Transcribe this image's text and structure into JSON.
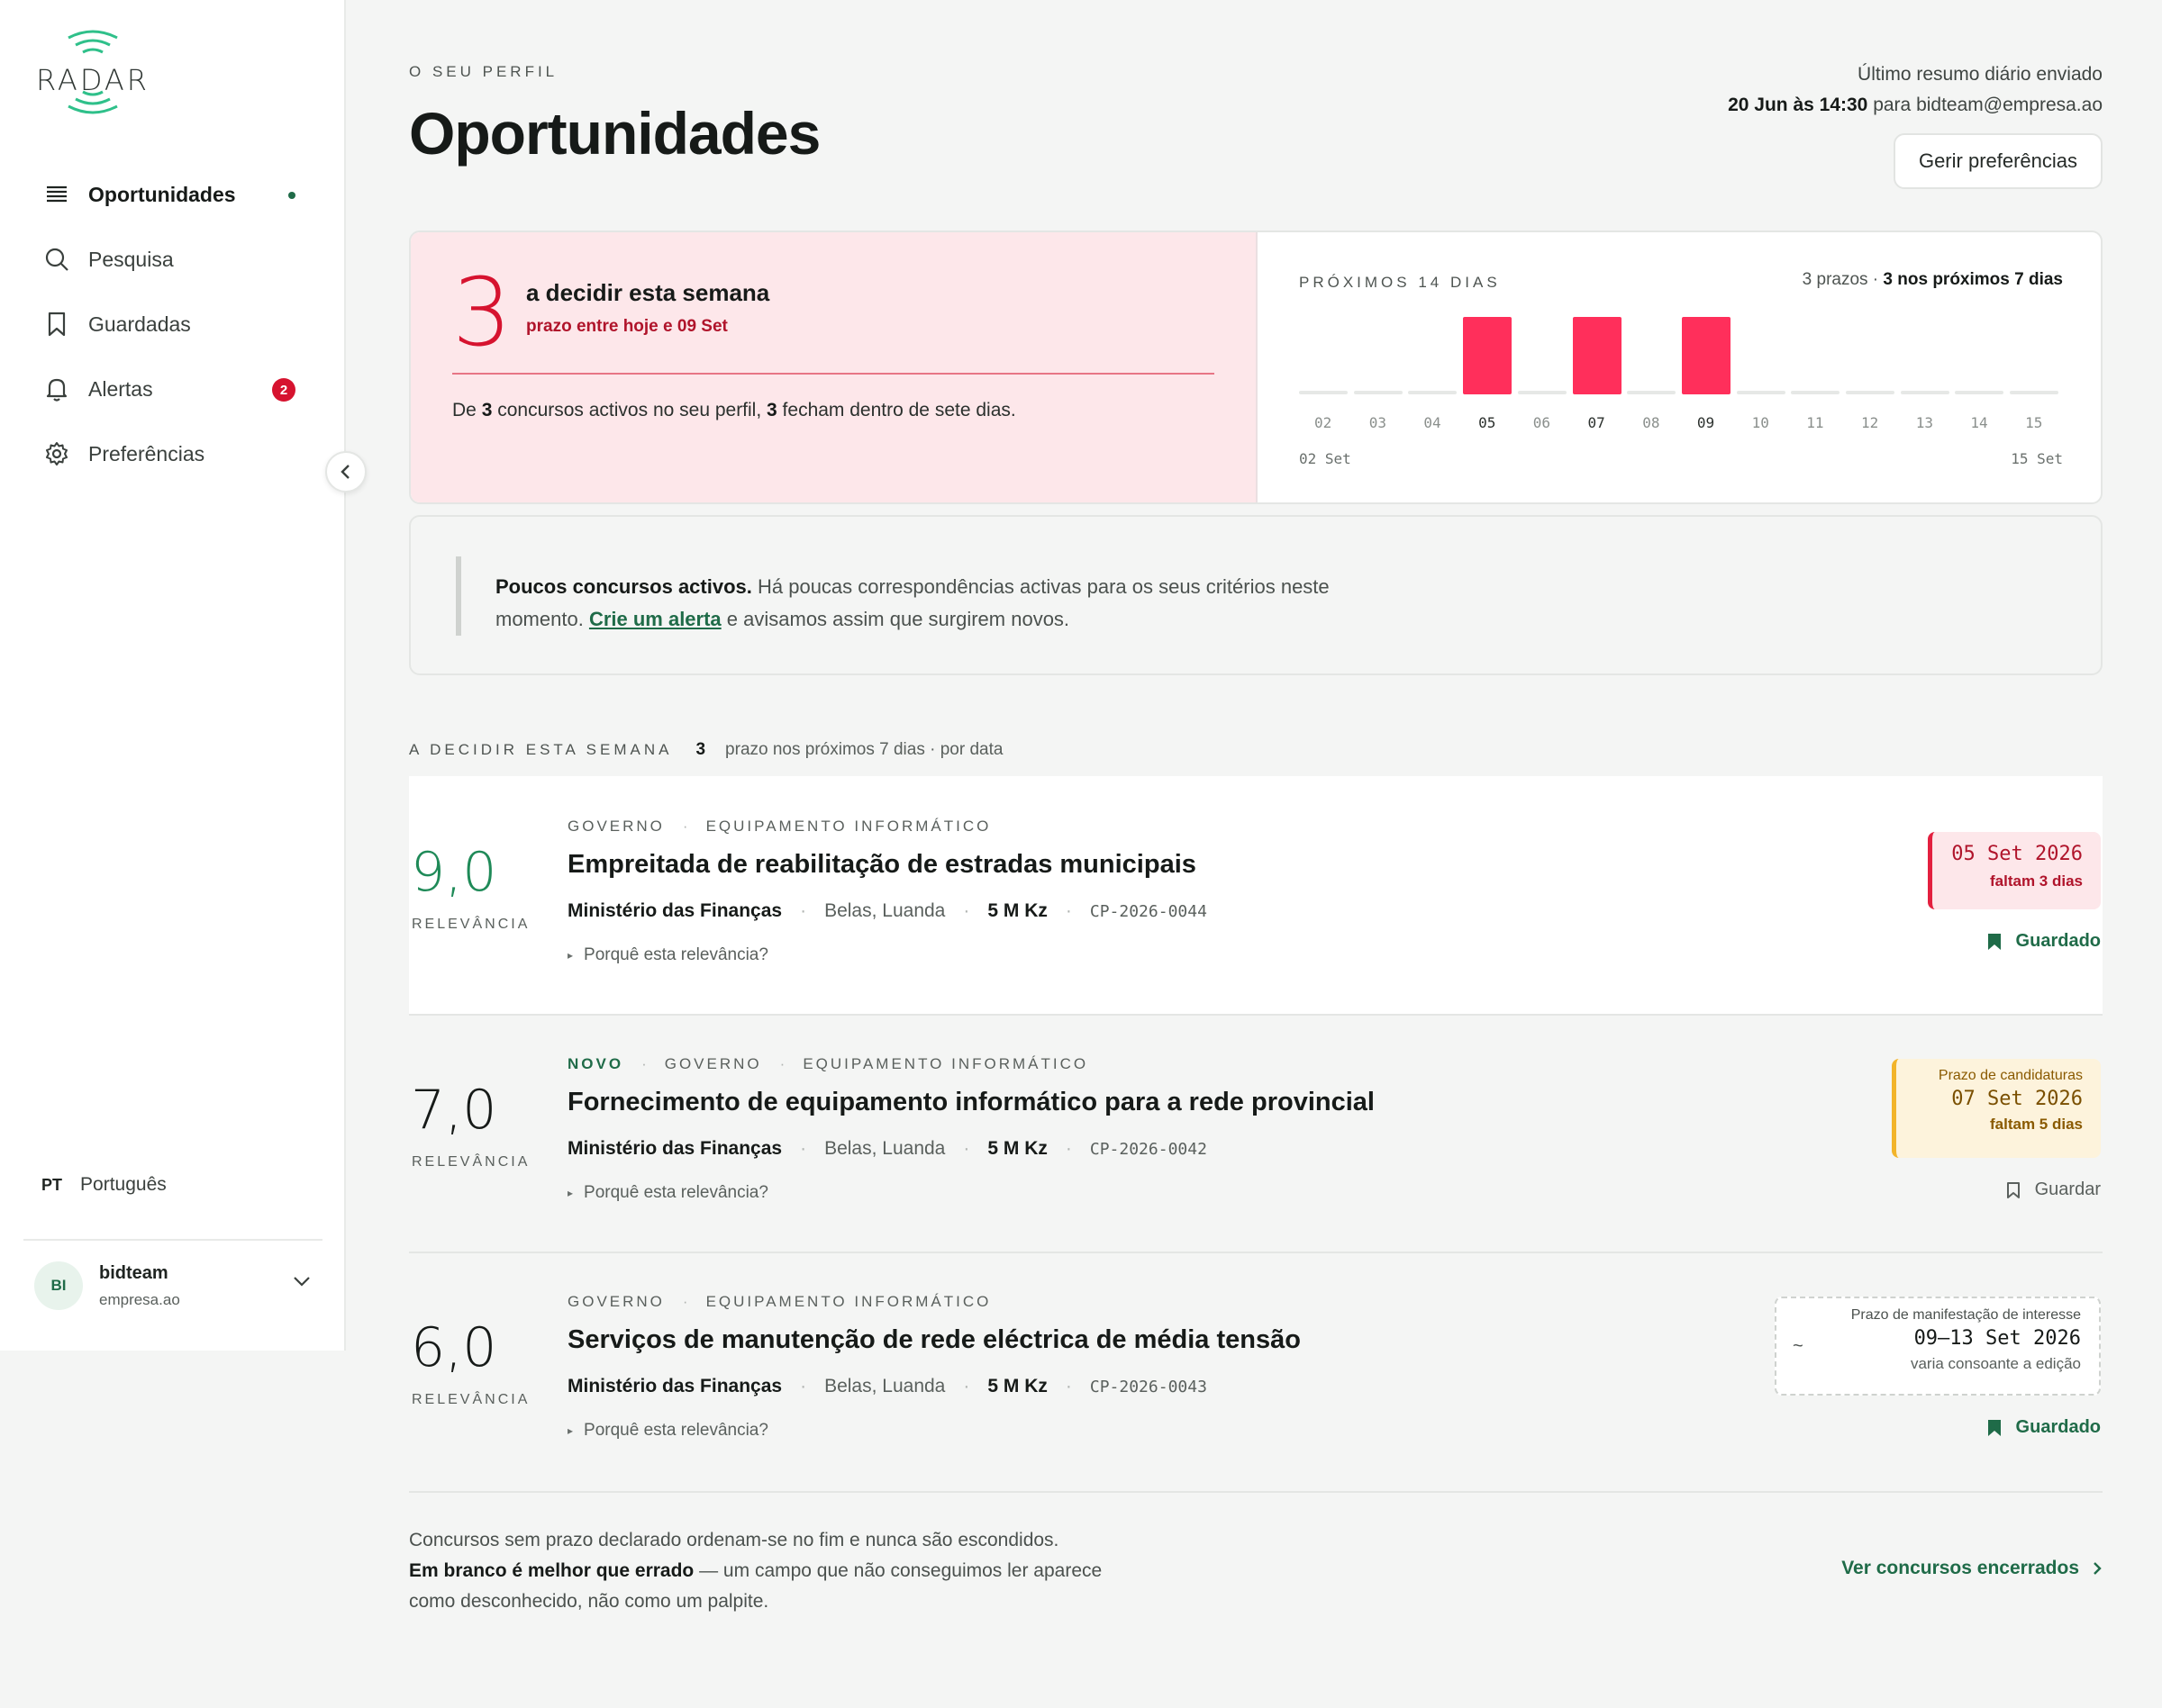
{
  "sidebar": {
    "logo_text": "RADAR",
    "items": [
      {
        "label": "Oportunidades",
        "icon": "list-icon",
        "active": true
      },
      {
        "label": "Pesquisa",
        "icon": "search-icon"
      },
      {
        "label": "Guardadas",
        "icon": "bookmark-icon"
      },
      {
        "label": "Alertas",
        "icon": "bell-icon",
        "badge": "2"
      },
      {
        "label": "Preferências",
        "icon": "gear-icon"
      }
    ],
    "language": {
      "code": "PT",
      "label": "Português"
    },
    "user": {
      "initials": "BI",
      "name": "bidteam",
      "domain": "empresa.ao"
    }
  },
  "header": {
    "eyebrow": "O SEU PERFIL",
    "title": "Oportunidades",
    "digest_label": "Último resumo diário enviado",
    "digest_when": "20 Jun às 14:30",
    "digest_to": "para bidteam@empresa.ao",
    "prefs_button": "Gerir preferências"
  },
  "summary": {
    "count": "3",
    "title": "a decidir esta semana",
    "subtitle": "prazo entre hoje e 09 Set",
    "text_pre": "De ",
    "text_active": "3",
    "text_mid": " concursos activos no seu perfil, ",
    "text_closing": "3",
    "text_post": " fecham dentro de sete dias."
  },
  "chart_data": {
    "type": "bar",
    "title": "PRÓXIMOS 14 DIAS",
    "meta_left": "3 prazos · ",
    "meta_right": "3 nos próximos 7 dias",
    "categories": [
      "02",
      "03",
      "04",
      "05",
      "06",
      "07",
      "08",
      "09",
      "10",
      "11",
      "12",
      "13",
      "14",
      "15"
    ],
    "values": [
      0,
      0,
      0,
      1,
      0,
      1,
      0,
      1,
      0,
      0,
      0,
      0,
      0,
      0
    ],
    "highlight": [
      "05",
      "07",
      "09"
    ],
    "range_start": "02 Set",
    "range_end": "15 Set",
    "bar_color": "#ff2f5b",
    "ylim": [
      0,
      1
    ]
  },
  "notice": {
    "title": "Poucos concursos activos.",
    "text": " Há poucas correspondências activas para os seus critérios neste momento. ",
    "link": "Crie um alerta",
    "text_end": " e avisamos assim que surgirem novos."
  },
  "section": {
    "title": "A DECIDIR ESTA SEMANA",
    "count": "3",
    "subtitle": "prazo nos próximos 7 dias · por data"
  },
  "tenders": [
    {
      "score": "9,0",
      "score_label": "RELEVÂNCIA",
      "tags": [
        "GOVERNO",
        "EQUIPAMENTO INFORMÁTICO"
      ],
      "title": "Empreitada de reabilitação de estradas municipais",
      "org": "Ministério das Finanças",
      "location": "Belas, Luanda",
      "value": "5 M Kz",
      "code": "CP-2026-0044",
      "why": "Porquê esta relevância?",
      "deadline_date": "05 Set 2026",
      "deadline_remaining": "faltam 3 dias",
      "save_label": "Guardado"
    },
    {
      "score": "7,0",
      "score_label": "RELEVÂNCIA",
      "new_tag": "NOVO",
      "tags": [
        "GOVERNO",
        "EQUIPAMENTO INFORMÁTICO"
      ],
      "title": "Fornecimento de equipamento informático para a rede provincial",
      "org": "Ministério das Finanças",
      "location": "Belas, Luanda",
      "value": "5 M Kz",
      "code": "CP-2026-0042",
      "why": "Porquê esta relevância?",
      "deadline_label": "Prazo de candidaturas",
      "deadline_date": "07 Set 2026",
      "deadline_remaining": "faltam 5 dias",
      "save_label": "Guardar"
    },
    {
      "score": "6,0",
      "score_label": "RELEVÂNCIA",
      "tags": [
        "GOVERNO",
        "EQUIPAMENTO INFORMÁTICO"
      ],
      "title": "Serviços de manutenção de rede eléctrica de média tensão",
      "org": "Ministério das Finanças",
      "location": "Belas, Luanda",
      "value": "5 M Kz",
      "code": "CP-2026-0043",
      "why": "Porquê esta relevância?",
      "deadline_label": "Prazo de manifestação de interesse",
      "deadline_approx": "~",
      "deadline_date": "09–13 Set 2026",
      "deadline_note": "varia consoante a edição",
      "save_label": "Guardado"
    }
  ],
  "footer": {
    "line1": "Concursos sem prazo declarado ordenam-se no fim e nunca são escondidos.",
    "bold": "Em branco é melhor que errado",
    "line2": " — um campo que não conseguimos ler aparece como desconhecido, não como um palpite.",
    "link": "Ver concursos encerrados"
  },
  "colors": {
    "accent": "#1f6b48",
    "danger": "#d6132f",
    "warning": "#f2b42a"
  }
}
